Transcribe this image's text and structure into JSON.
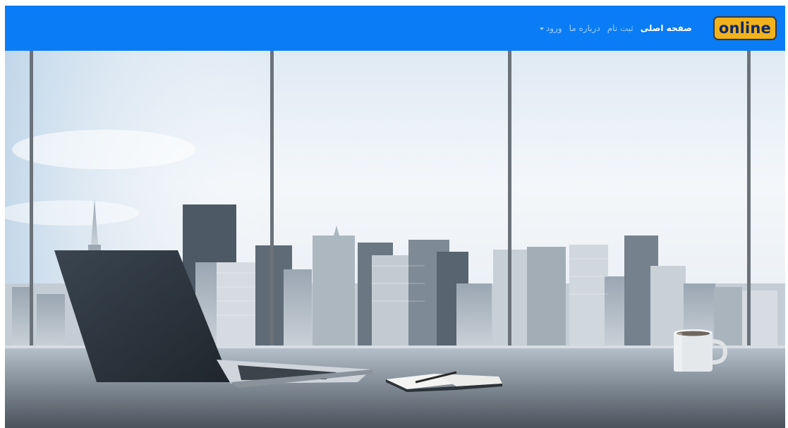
{
  "navbar": {
    "brand": "online",
    "links": [
      {
        "label": "صفحه اصلی",
        "active": true
      },
      {
        "label": "ثبت نام",
        "active": false
      },
      {
        "label": "درباره ما",
        "active": false
      },
      {
        "label": "ورود",
        "active": false,
        "dropdown": true
      }
    ]
  },
  "colors": {
    "navbar_bg": "#0a7cf5",
    "brand_bg": "#f2b21b",
    "brand_text": "#0d2a66"
  },
  "hero": {
    "icons": [
      "laptop-icon",
      "notebook-icon",
      "coffee-mug-icon"
    ]
  }
}
